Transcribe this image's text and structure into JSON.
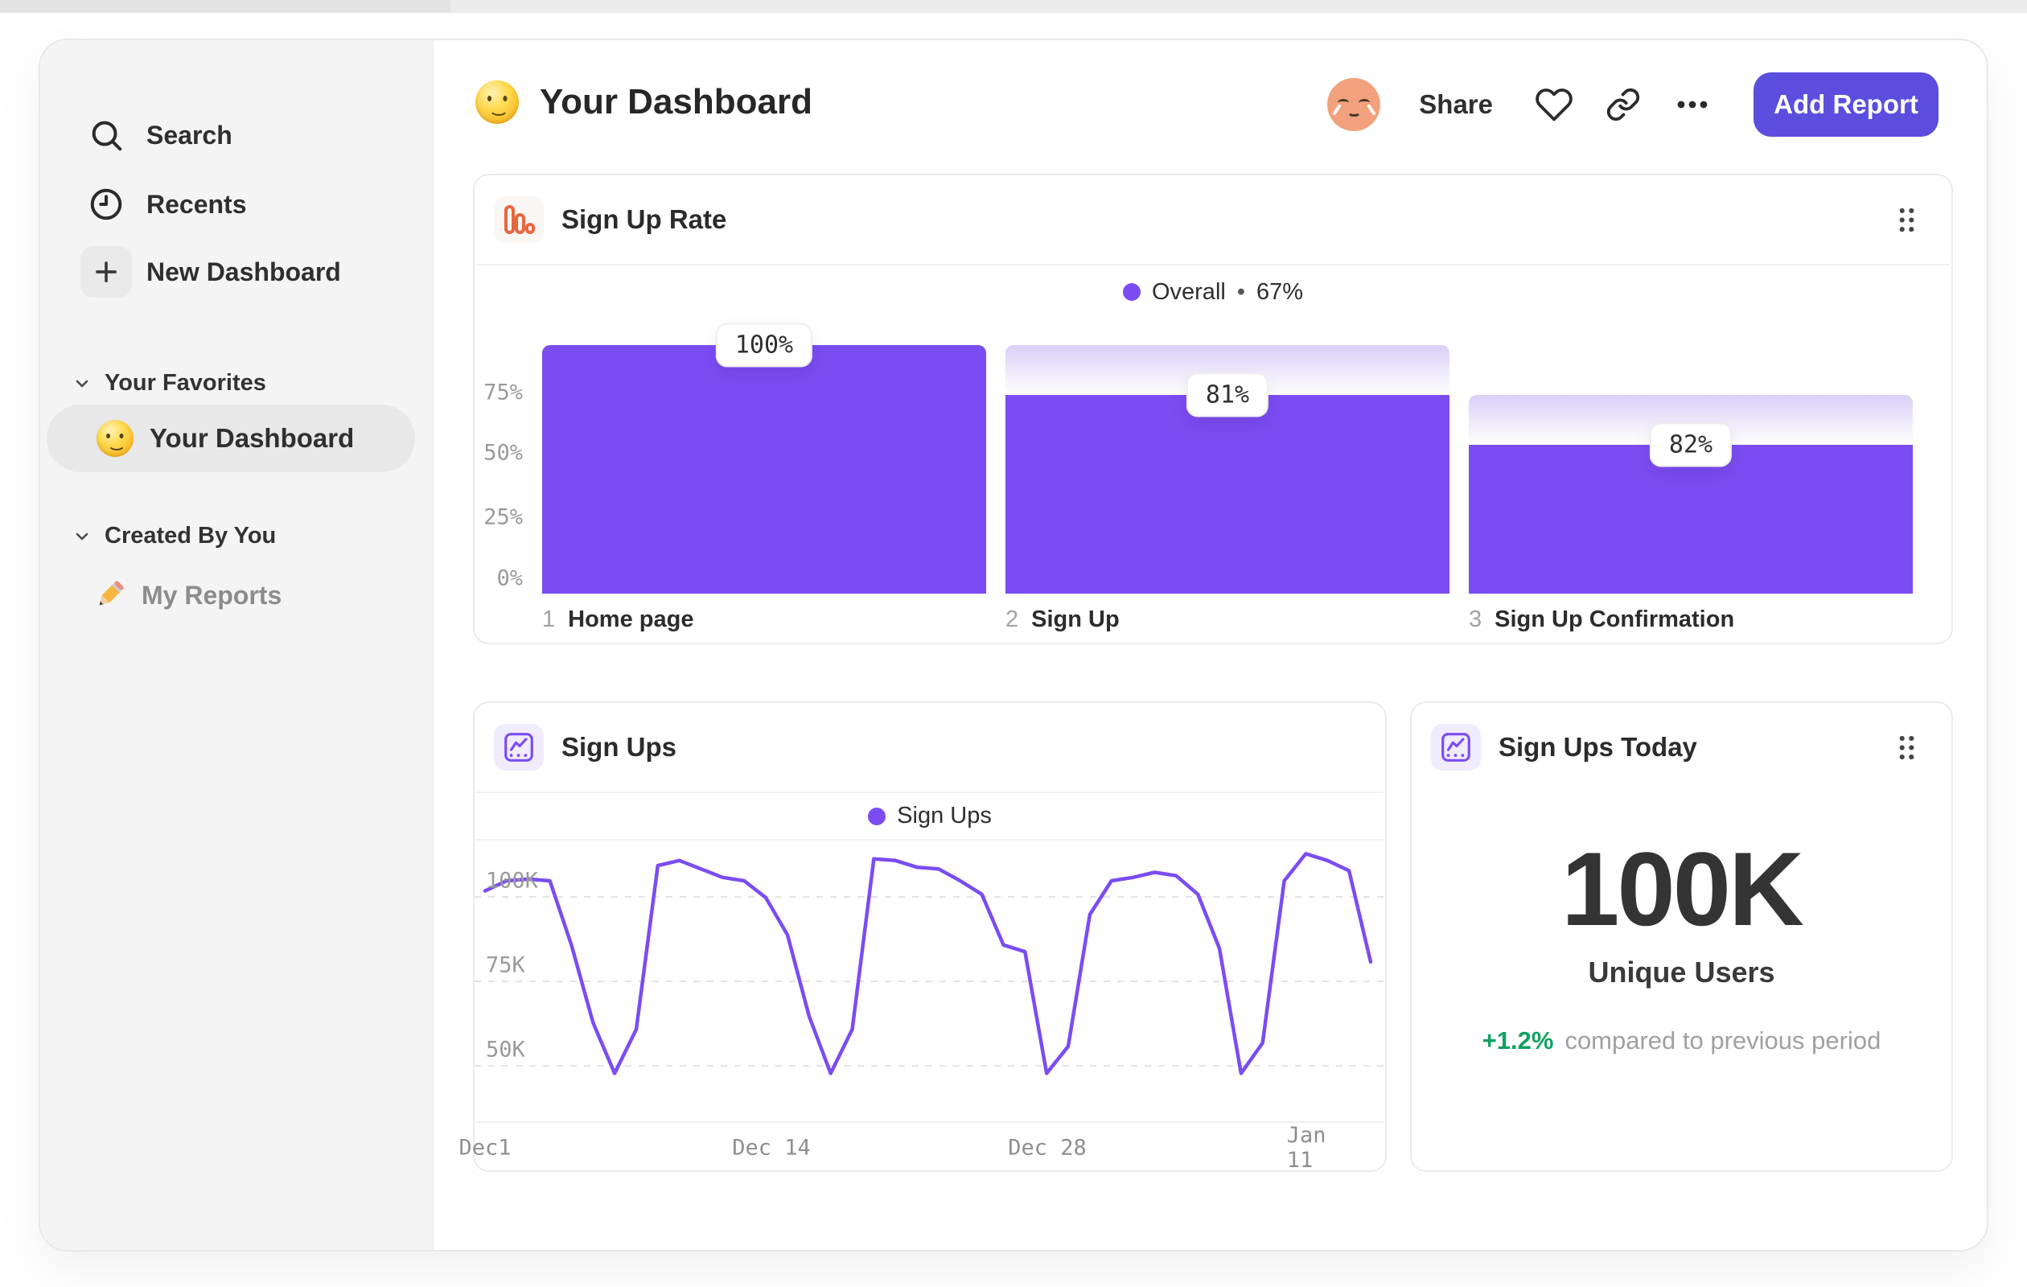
{
  "colors": {
    "accent": "#7B4CF2",
    "accent_dark": "#5A4EDE",
    "coral": "#E96540",
    "green": "#0FA25F",
    "ghost_gradient_top": "#D9CFF8"
  },
  "sidebar": {
    "items": [
      {
        "label": "Search"
      },
      {
        "label": "Recents"
      },
      {
        "label": "New Dashboard"
      }
    ],
    "sections": [
      {
        "label": "Your Favorites",
        "items": [
          {
            "label": "Your Dashboard",
            "active": true
          }
        ]
      },
      {
        "label": "Created By You",
        "items": [
          {
            "label": "My Reports"
          }
        ]
      }
    ]
  },
  "header": {
    "title": "Your Dashboard",
    "share": "Share",
    "add_report": "Add Report"
  },
  "chart_data": [
    {
      "type": "bar",
      "subtype": "funnel",
      "title": "Sign Up Rate",
      "legend": {
        "series": "Overall",
        "separator": "•",
        "overall": "67%"
      },
      "y_ticks": [
        "75%",
        "50%",
        "25%",
        "0%"
      ],
      "ylim": [
        0,
        100
      ],
      "bars": [
        {
          "step": "1",
          "category": "Home page",
          "value_label": "100%",
          "render_pct": 100,
          "ghost_pct": 100
        },
        {
          "step": "2",
          "category": "Sign Up",
          "value_label": "81%",
          "render_pct": 80,
          "ghost_pct": 100
        },
        {
          "step": "3",
          "category": "Sign Up Confirmation",
          "value_label": "82%",
          "render_pct": 60,
          "ghost_pct": 80
        }
      ]
    },
    {
      "type": "line",
      "title": "Sign Ups",
      "legend": "Sign Ups",
      "unit": "K",
      "y_ticks": [
        "100K",
        "75K",
        "50K"
      ],
      "x_ticks": [
        "Dec1",
        "Dec 14",
        "Dec 28",
        "Jan 11"
      ],
      "ylim_k": [
        40,
        110
      ],
      "grid": "dashed-horizontal",
      "legend_position": "top-center",
      "values_k": [
        97,
        100,
        100.5,
        100,
        81,
        58,
        43,
        56,
        104.5,
        106,
        103.5,
        101,
        100,
        95,
        84,
        60,
        43,
        56,
        106.5,
        106,
        104,
        103.5,
        100,
        96,
        81,
        79,
        43,
        51,
        90,
        100,
        101,
        102.5,
        101.5,
        96,
        80,
        43,
        52,
        100,
        108,
        106,
        103,
        76
      ]
    },
    {
      "type": "stat",
      "title": "Sign Ups Today",
      "value": "100K",
      "label": "Unique Users",
      "delta": "+1.2%",
      "delta_caption": "compared to previous period"
    }
  ]
}
